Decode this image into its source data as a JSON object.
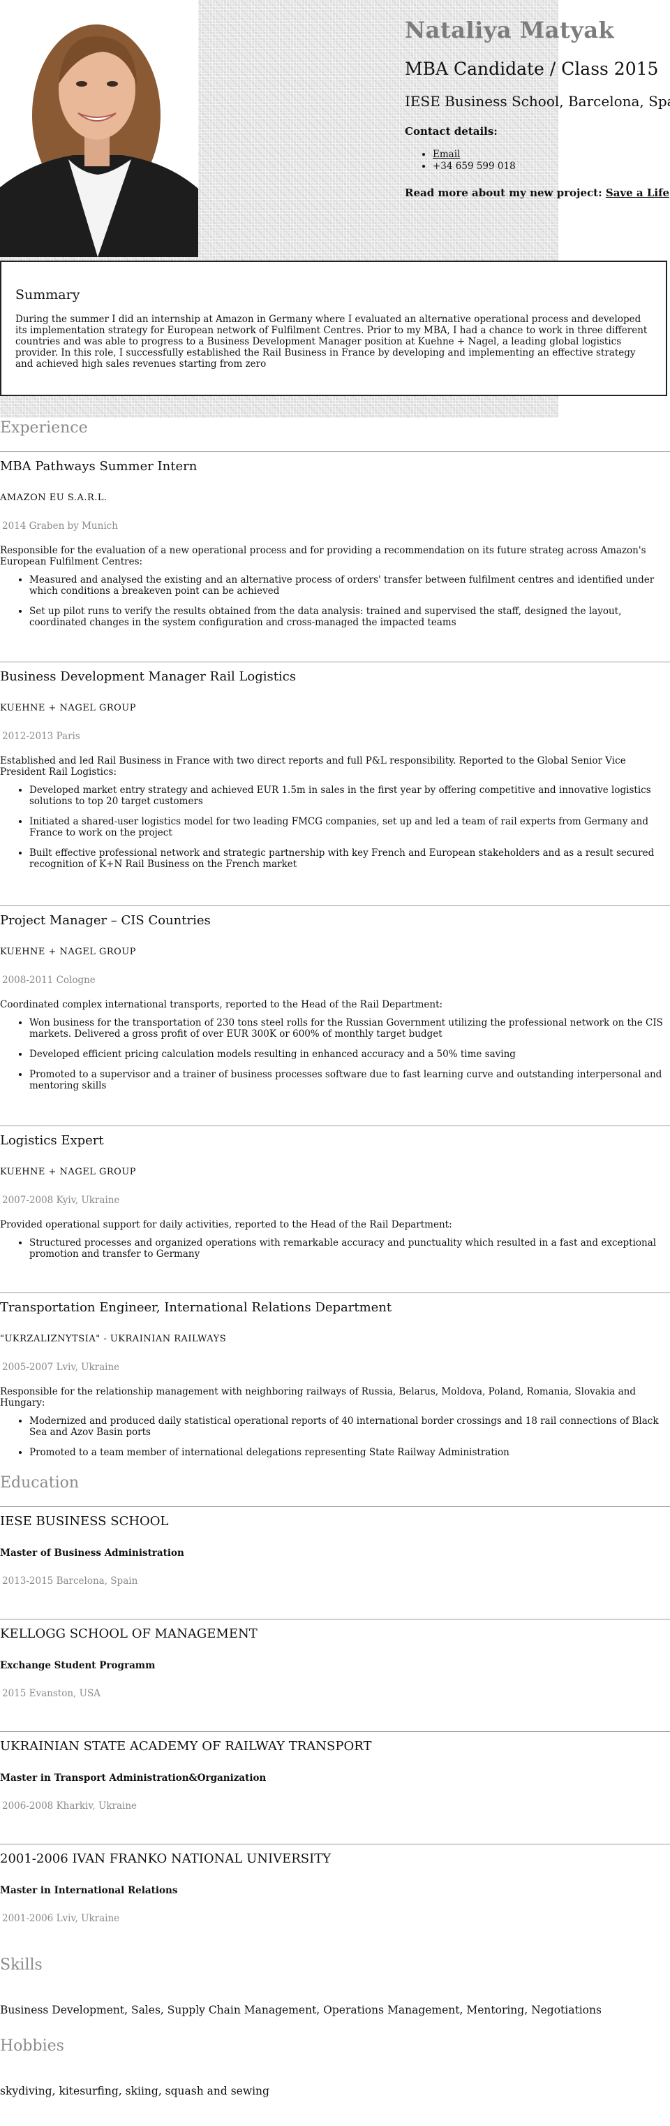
{
  "header": {
    "name": "Nataliya Matyak",
    "subtitle": "MBA Candidate / Class 2015",
    "school": "IESE Business School, Barcelona, Spain",
    "contact_heading": "Contact details:",
    "email_label": "Email",
    "phone": "+34 659 599 018",
    "project_text": "Read more about my new project:",
    "project_link": "Save a Life"
  },
  "summary": {
    "heading": "Summary",
    "text": "During the summer I did an internship at Amazon in Germany where I evaluated an alternative operational process and developed its implementation strategy for European network of Fulfilment Centres. Prior to my MBA, I had a chance to work in three different countries and was able to progress to a Business Development Manager position at Kuehne + Nagel, a leading global logistics provider. In this role, I successfully established the Rail Business in France by developing and implementing an effective strategy and achieved high sales revenues starting from zero"
  },
  "experience": {
    "heading": "Experience",
    "jobs": [
      {
        "title": "MBA Pathways Summer Intern",
        "org": "AMAZON EU S.A.R.L.",
        "meta": "2014 Graben by Munich",
        "desc": "Responsible for the evaluation of a new operational process and for providing a recommendation on its future strateg across Amazon's European Fulfilment Centres:",
        "bullets": [
          "Measured and analysed the existing and an alternative process of orders' transfer between fulfilment centres and identified under which conditions a breakeven point can be achieved",
          "Set up pilot runs to verify the results obtained from the data analysis: trained and supervised the staff, designed the layout, coordinated changes in the system configuration and cross-managed the impacted teams"
        ]
      },
      {
        "title": "Business Development Manager Rail Logistics",
        "org": "KUEHNE + NAGEL GROUP",
        "meta": "2012-2013 Paris",
        "desc": "Established and led Rail Business in France with two direct reports and full P&L responsibility. Reported to the Global Senior Vice President Rail Logistics:",
        "bullets": [
          "Developed market entry strategy and achieved EUR 1.5m in sales in the first year by offering competitive and innovative logistics solutions to top 20 target customers",
          "Initiated a shared-user logistics model for two leading FMCG companies, set up and led a team of rail experts from Germany and France to work on the project",
          "Built effective professional network and strategic partnership with key French and European stakeholders and as a result secured recognition of K+N Rail Business on the French market"
        ]
      },
      {
        "title": "Project Manager – CIS Countries",
        "org": "KUEHNE + NAGEL GROUP",
        "meta": "2008-2011 Cologne",
        "desc": "Coordinated complex international transports, reported to the Head of the Rail Department:",
        "bullets": [
          "Won business for the transportation of 230 tons steel rolls for the Russian Government utilizing the professional network on the CIS markets. Delivered a gross profit of over EUR 300K or 600% of monthly target budget",
          "Developed efficient pricing calculation models resulting in enhanced accuracy and a 50% time saving",
          "Promoted to a supervisor and a trainer of business processes software due to fast learning curve and outstanding interpersonal and mentoring skills"
        ]
      },
      {
        "title": "Logistics Expert",
        "org": "KUEHNE + NAGEL GROUP",
        "meta": "2007-2008 Kyiv, Ukraine",
        "desc": "Provided operational support for daily activities, reported to the Head of the Rail Department:",
        "bullets": [
          "Structured processes and organized operations with remarkable accuracy and punctuality which resulted in a fast and exceptional promotion and transfer to Germany"
        ]
      },
      {
        "title": "Transportation Engineer, International Relations Department",
        "org": "\"UKRZALIZNYTSIA\" - UKRAINIAN RAILWAYS",
        "meta": "2005-2007 Lviv, Ukraine",
        "desc": "Responsible for the relationship management with neighboring railways of Russia, Belarus, Moldova, Poland, Romania, Slovakia and Hungary:",
        "bullets": [
          "Modernized and produced daily statistical operational reports of 40 international border crossings and 18 rail connections of Black Sea and Azov Basin ports",
          "Promoted to a team member of international delegations representing State Railway Administration"
        ]
      }
    ]
  },
  "education": {
    "heading": "Education",
    "items": [
      {
        "school": "IESE BUSINESS SCHOOL",
        "degree": "Master of Business Administration",
        "meta": "2013-2015 Barcelona, Spain"
      },
      {
        "school": "KELLOGG SCHOOL OF MANAGEMENT",
        "degree": "Exchange Student Programm",
        "meta": "2015 Evanston, USA"
      },
      {
        "school": "UKRAINIAN STATE ACADEMY OF RAILWAY TRANSPORT",
        "degree": "Master in Transport Administration&Organization",
        "meta": "2006-2008 Kharkiv, Ukraine"
      },
      {
        "school": "2001-2006 IVAN FRANKO NATIONAL UNIVERSITY",
        "degree": "Master in International Relations",
        "meta": "2001-2006 Lviv, Ukraine"
      }
    ]
  },
  "skills": {
    "heading": "Skills",
    "text": "Business Development, Sales, Supply Chain Management, Operations Management, Mentoring, Negotiations"
  },
  "hobbies": {
    "heading": "Hobbies",
    "text": "skydiving, kitesurfing, skiing, squash and sewing"
  }
}
